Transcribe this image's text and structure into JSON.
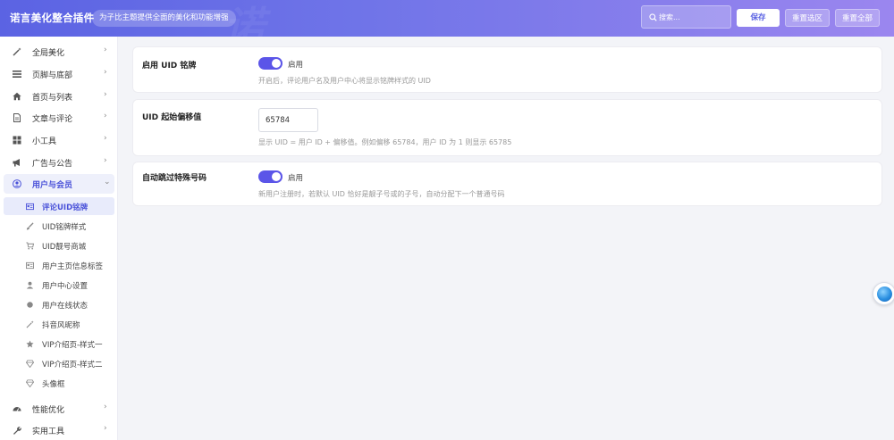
{
  "header": {
    "brand": "诺言美化整合插件",
    "tagline": "为子比主题提供全面的美化和功能增强",
    "search_placeholder": "搜索...",
    "save_label": "保存",
    "reset_selection_label": "重置选区",
    "reset_all_label": "重置全部"
  },
  "sidebar": {
    "items": [
      {
        "label": "全局美化",
        "icon": "magic-wand-icon"
      },
      {
        "label": "页脚与底部",
        "icon": "menu-lines-icon"
      },
      {
        "label": "首页与列表",
        "icon": "home-icon"
      },
      {
        "label": "文章与评论",
        "icon": "document-icon"
      },
      {
        "label": "小工具",
        "icon": "grid-icon"
      },
      {
        "label": "广告与公告",
        "icon": "megaphone-icon"
      },
      {
        "label": "用户与会员",
        "icon": "user-circle-icon"
      },
      {
        "label": "性能优化",
        "icon": "dashboard-icon"
      },
      {
        "label": "实用工具",
        "icon": "wrench-icon"
      }
    ],
    "sub_items": [
      {
        "label": "评论UID铭牌",
        "icon": "id-card-icon"
      },
      {
        "label": "UID铭牌样式",
        "icon": "brush-icon"
      },
      {
        "label": "UID靓号商城",
        "icon": "cart-icon"
      },
      {
        "label": "用户主页信息标签",
        "icon": "id-card-icon"
      },
      {
        "label": "用户中心设置",
        "icon": "user-icon"
      },
      {
        "label": "用户在线状态",
        "icon": "dot-icon"
      },
      {
        "label": "抖音风昵称",
        "icon": "magic-wand-icon"
      },
      {
        "label": "VIP介绍页-样式一",
        "icon": "star-icon"
      },
      {
        "label": "VIP介绍页-样式二",
        "icon": "diamond-icon"
      },
      {
        "label": "头像框",
        "icon": "diamond-icon"
      }
    ]
  },
  "settings": {
    "enable_uid": {
      "title": "启用 UID 铭牌",
      "toggle_label": "启用",
      "enabled": true,
      "description": "开启后，评论用户名及用户中心将显示铭牌样式的 UID"
    },
    "uid_offset": {
      "title": "UID 起始偏移值",
      "value": "65784",
      "description": "显示 UID = 用户 ID + 偏移值。例如偏移 65784，用户 ID 为 1 则显示 65785"
    },
    "skip_special": {
      "title": "自动跳过特殊号码",
      "toggle_label": "启用",
      "enabled": true,
      "description": "新用户注册时，若默认 UID 恰好是靓子号或的子号，自动分配下一个普通号码"
    }
  },
  "colors": {
    "accent": "#5b55e8",
    "header_start": "#5b63e3",
    "header_end": "#9b86ef"
  }
}
